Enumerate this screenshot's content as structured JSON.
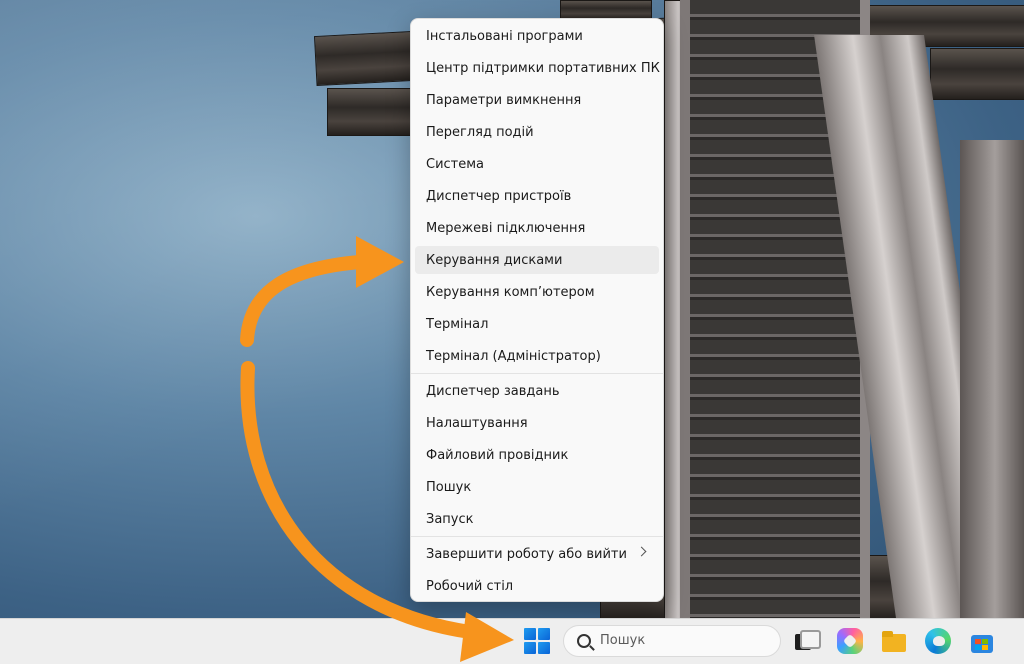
{
  "context_menu": {
    "items": [
      {
        "label": "Інстальовані програми"
      },
      {
        "label": "Центр підтримки портативних ПК"
      },
      {
        "label": "Параметри вимкнення"
      },
      {
        "label": "Перегляд подій"
      },
      {
        "label": "Система"
      },
      {
        "label": "Диспетчер пристроїв"
      },
      {
        "label": "Мережеві підключення"
      },
      {
        "label": "Керування дисками"
      },
      {
        "label": "Керування комп’ютером"
      },
      {
        "label": "Термінал"
      },
      {
        "label": "Термінал (Адміністратор)"
      },
      {
        "label": "Диспетчер завдань"
      },
      {
        "label": "Налаштування"
      },
      {
        "label": "Файловий провідник"
      },
      {
        "label": "Пошук"
      },
      {
        "label": "Запуск"
      },
      {
        "label": "Завершити роботу або вийти"
      },
      {
        "label": "Робочий стіл"
      }
    ],
    "highlighted": "Керування дисками"
  },
  "taskbar": {
    "search_placeholder": "Пошук",
    "icons": [
      "windows-start-icon",
      "search-icon",
      "task-view-icon",
      "copilot-icon",
      "file-explorer-icon",
      "edge-icon",
      "store-icon"
    ]
  },
  "annotation": {
    "arrow_color": "#f7941d"
  }
}
